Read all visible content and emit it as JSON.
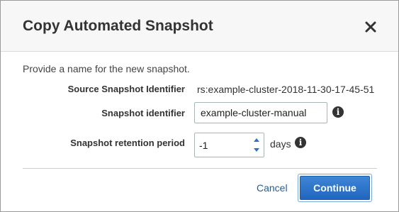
{
  "dialog": {
    "title": "Copy Automated Snapshot",
    "close_icon": "close-icon",
    "intro_text": "Provide a name for the new snapshot."
  },
  "fields": {
    "source": {
      "label": "Source Snapshot Identifier",
      "value": "rs:example-cluster-2018-11-30-17-45-51"
    },
    "identifier": {
      "label": "Snapshot identifier",
      "value": "example-cluster-manual",
      "info_icon": "info-icon"
    },
    "retention": {
      "label": "Snapshot retention period",
      "value": "-1",
      "unit": "days",
      "info_icon": "info-icon"
    }
  },
  "actions": {
    "cancel_label": "Cancel",
    "continue_label": "Continue"
  },
  "colors": {
    "primary_button": "#2a72c8",
    "link": "#1f5d9c",
    "header_bg": "#f7f7f7"
  }
}
